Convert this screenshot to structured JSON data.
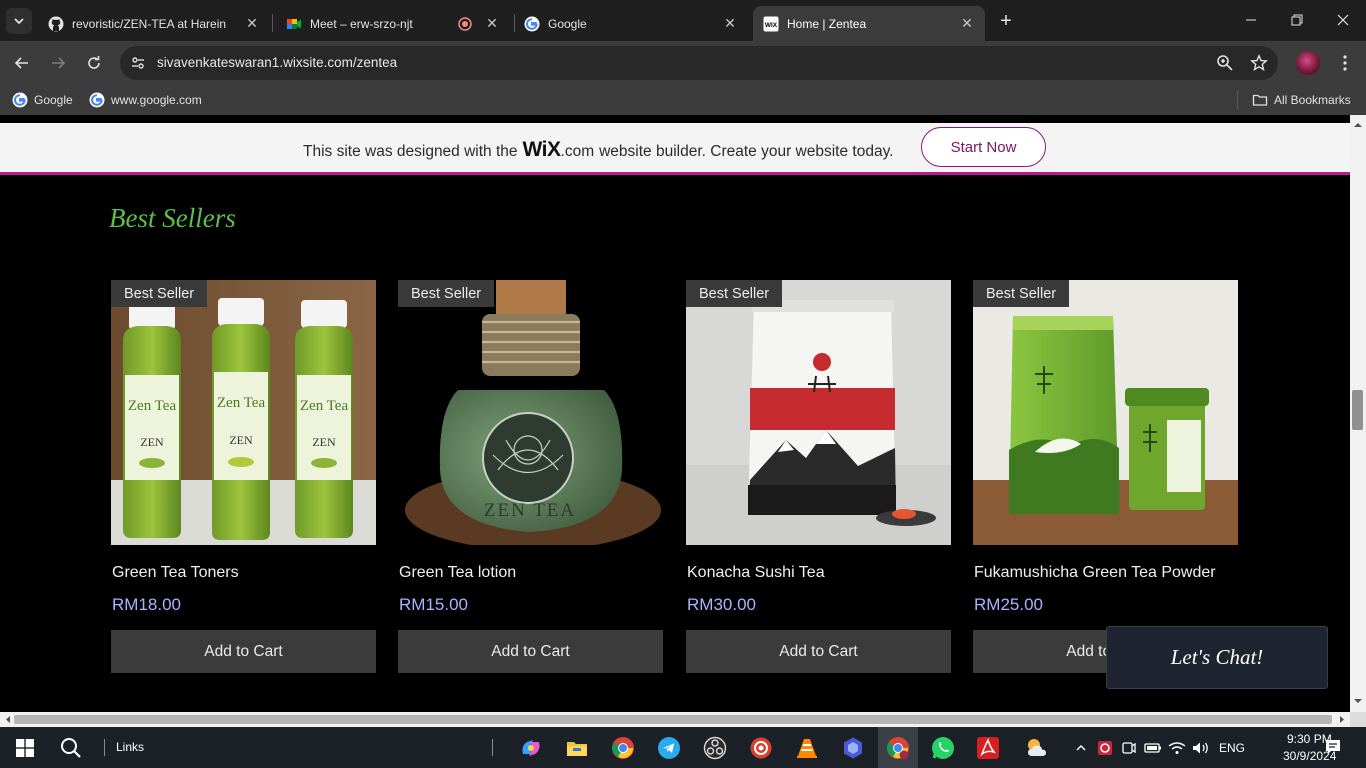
{
  "browser": {
    "tabs": [
      {
        "title": "revoristic/ZEN-TEA at Harein",
        "favicon": "github-icon"
      },
      {
        "title": "Meet – erw-srzo-njt",
        "favicon": "google-meet-icon"
      },
      {
        "title": "Google",
        "favicon": "google-icon"
      },
      {
        "title": "Home | Zentea",
        "favicon": "wix-icon",
        "active": true
      }
    ],
    "url": "sivavenkateswaran1.wixsite.com/zentea",
    "bookmarks": [
      {
        "label": "Google"
      },
      {
        "label": "www.google.com"
      }
    ],
    "all_bookmarks_label": "All Bookmarks"
  },
  "wix_banner": {
    "text_before": "This site was designed with the",
    "logo": "WiX",
    "dotcom": ".com",
    "text_after": "website builder. Create your website today.",
    "button": "Start Now"
  },
  "section": {
    "title": "Best Sellers"
  },
  "products": [
    {
      "badge": "Best Seller",
      "name": "Green Tea Toners",
      "price": "RM18.00",
      "button": "Add to Cart",
      "image_label": "Zen Tea",
      "image_sub": "ZEN"
    },
    {
      "badge": "Best Seller",
      "name": "Green Tea lotion",
      "price": "RM15.00",
      "button": "Add to Cart",
      "image_label": "ZEN TEA"
    },
    {
      "badge": "Best Seller",
      "name": "Konacha Sushi Tea",
      "price": "RM30.00",
      "button": "Add to Cart"
    },
    {
      "badge": "Best Seller",
      "name": "Fukamushicha Green Tea Powder",
      "price": "RM25.00",
      "button": "Add to Cart"
    }
  ],
  "chat": {
    "label": "Let's Chat!"
  },
  "taskbar": {
    "search_label": "Links",
    "language": "ENG",
    "time": "9:30 PM",
    "date": "30/9/2024"
  },
  "colors": {
    "wix_accent": "#b41b8b",
    "title_green": "#5cc04a",
    "price_blue": "#a8b2ff"
  }
}
